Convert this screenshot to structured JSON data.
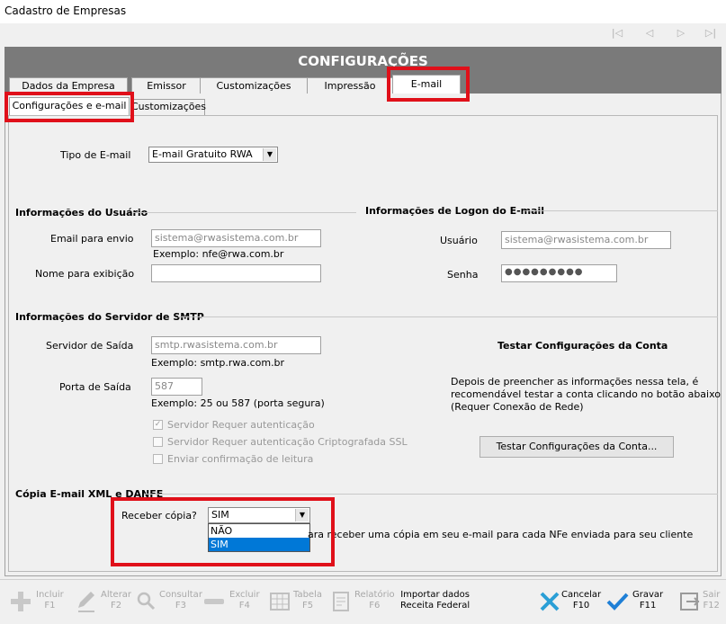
{
  "window": {
    "title": "Cadastro de Empresas"
  },
  "header": {
    "title": "CONFIGURAÇÕES"
  },
  "tabs": [
    "Dados da Empresa",
    "Emissor",
    "Customizações",
    "Impressão",
    "E-mail"
  ],
  "subtabs": [
    "Configurações e e-mail",
    "Customizações"
  ],
  "tipo_email": {
    "label": "Tipo de E-mail",
    "value": "E-mail Gratuito RWA"
  },
  "usuario_section": {
    "title": "Informações do Usuário",
    "email_label": "Email para envio",
    "email_value": "sistema@rwasistema.com.br",
    "email_hint": "Exemplo: nfe@rwa.com.br",
    "nome_label": "Nome para exibição",
    "nome_value": ""
  },
  "logon_section": {
    "title": "Informações de Logon do E-mail",
    "usuario_label": "Usuário",
    "usuario_value": "sistema@rwasistema.com.br",
    "senha_label": "Senha",
    "senha_value": "●●●●●●●●●"
  },
  "smtp_section": {
    "title": "Informações do Servidor de SMTP",
    "servidor_label": "Servidor de Saída",
    "servidor_value": "smtp.rwasistema.com.br",
    "servidor_hint": "Exemplo: smtp.rwa.com.br",
    "porta_label": "Porta de Saída",
    "porta_value": "587",
    "porta_hint": "Exemplo: 25 ou 587 (porta segura)",
    "chk1": "Servidor Requer autenticação",
    "chk2": "Servidor Requer autenticação Criptografada SSL",
    "chk3": "Enviar confirmação de leitura"
  },
  "teste": {
    "title": "Testar Configurações da Conta",
    "text1": "Depois de preencher as informações nessa tela, é",
    "text2": "recomendável testar a conta clicando no botão abaixo",
    "text3": "(Requer Conexão de Rede)",
    "button": "Testar Configurações da Conta..."
  },
  "copia": {
    "title": "Cópia E-mail XML e DANFE",
    "label": "Receber cópia?",
    "value": "SIM",
    "options": [
      "NÃO",
      "SIM"
    ],
    "desc_before": "ara r",
    "desc_after": "eceber uma cópia em seu e-mail para cada NFe enviada para seu cliente"
  },
  "toolbar": {
    "incluir": [
      "Incluir",
      "F1"
    ],
    "alterar": [
      "Alterar",
      "F2"
    ],
    "consultar": [
      "Consultar",
      "F3"
    ],
    "excluir": [
      "Excluir",
      "F4"
    ],
    "tabela": [
      "Tabela",
      "F5"
    ],
    "relatorio": [
      "Relatório",
      "F6"
    ],
    "importar": [
      "Importar dados",
      "Receita Federal"
    ],
    "cancelar": [
      "Cancelar",
      "F10"
    ],
    "gravar": [
      "Gravar",
      "F11"
    ],
    "sair": [
      "Sair",
      "F12"
    ]
  },
  "colors": {
    "header_bg": "#7a7a7a",
    "highlight": "#e0101a",
    "check_blue": "#1e7fd6",
    "cancel_blue": "#2a9fd6"
  }
}
